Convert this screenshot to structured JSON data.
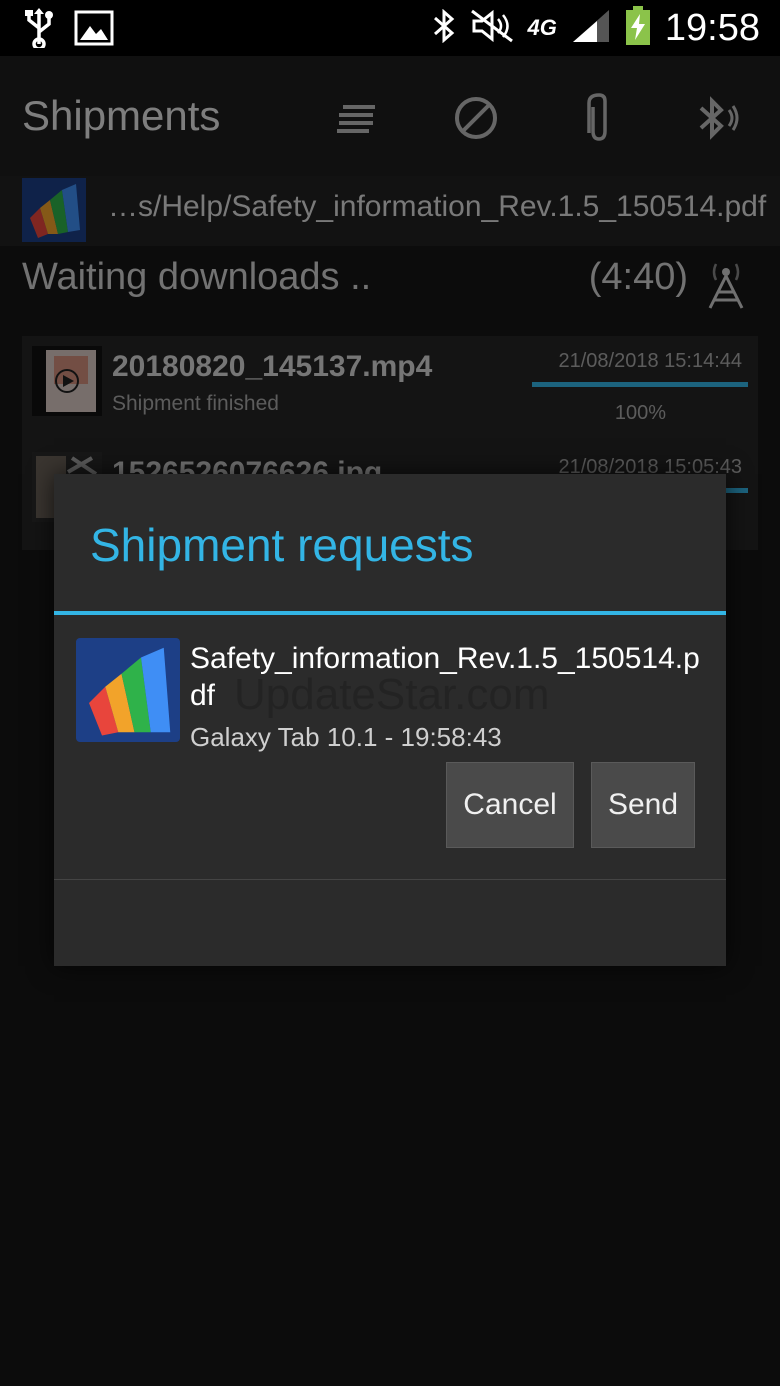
{
  "status_bar": {
    "time": "19:58",
    "icons": [
      "usb-icon",
      "image-icon",
      "bluetooth-icon",
      "mute-icon",
      "4g-icon",
      "signal-icon",
      "battery-charging-icon"
    ],
    "network": "4G"
  },
  "action_bar": {
    "title": "Shipments",
    "actions": [
      "list-icon",
      "cancel-icon",
      "attach-icon",
      "bluetooth-audio-icon"
    ]
  },
  "current_file": {
    "name": "…s/Help/Safety_information_Rev.1.5_150514.pdf",
    "status": "Waiting downloads ..",
    "timer": "(4:40)"
  },
  "transfers": [
    {
      "file": "20180820_145137.mp4",
      "status": "Shipment finished",
      "date": "21/08/2018 15:14:44",
      "progress": 1.0,
      "progress_label": "100%"
    },
    {
      "file": "1526526076626.jpg",
      "date": "21/08/2018 15:05:43",
      "progress": 1.0
    }
  ],
  "dialog": {
    "title": "Shipment requests",
    "file_name": "Safety_information_Rev.1.5_150514.pdf",
    "source": "Galaxy Tab 10.1 - 19:58:43",
    "cancel_label": "Cancel",
    "send_label": "Send",
    "watermark": "UpdateStar.com"
  },
  "colors": {
    "accent": "#33b5e5",
    "background": "#161616",
    "dialog": "#2b2b2b"
  }
}
